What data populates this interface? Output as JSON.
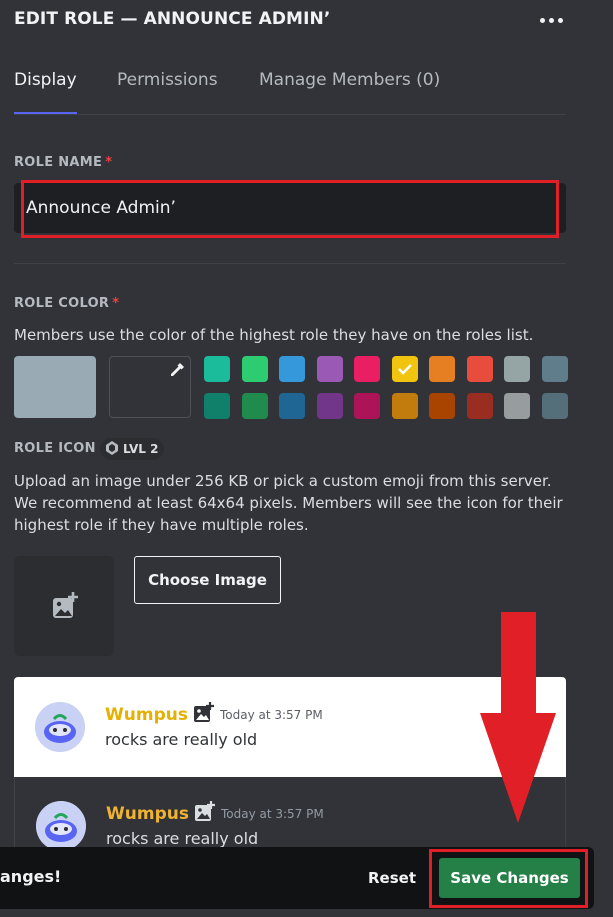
{
  "header": {
    "title": "EDIT ROLE — ANNOUNCE ADMIN’",
    "more_icon": "more-dots-icon"
  },
  "tabs": [
    {
      "label": "Display",
      "active": true
    },
    {
      "label": "Permissions",
      "active": false
    },
    {
      "label": "Manage Members (0)",
      "active": false
    }
  ],
  "role_name": {
    "label": "ROLE NAME",
    "required_mark": "*",
    "value": "Announce Admin’"
  },
  "role_color": {
    "label": "ROLE COLOR",
    "required_mark": "*",
    "description": "Members use the color of the highest role they have on the roles list.",
    "default_color": "#99aab5",
    "picker_icon": "eyedropper-icon",
    "selected": "#f1c40f",
    "row1": [
      "#1abc9c",
      "#2ecc71",
      "#3498db",
      "#9b59b6",
      "#e91e63",
      "#f1c40f",
      "#e67e22",
      "#e74c3c",
      "#95a5a6",
      "#607d8b"
    ],
    "row2": [
      "#11806a",
      "#1f8b4c",
      "#206694",
      "#71368a",
      "#ad1457",
      "#c27c0e",
      "#a84300",
      "#992d22",
      "#979c9f",
      "#546e7a"
    ]
  },
  "role_icon": {
    "label": "ROLE ICON",
    "level_badge": "LVL 2",
    "description": "Upload an image under 256 KB or pick a custom emoji from this server. We recommend at least 64x64 pixels. Members will see the icon for their highest role if they have multiple roles.",
    "upload_icon": "add-image-icon",
    "choose_label": "Choose Image"
  },
  "preview": [
    {
      "theme": "light",
      "username": "Wumpus",
      "timestamp": "Today at 3:57 PM",
      "message": "rocks are really old"
    },
    {
      "theme": "dark",
      "username": "Wumpus",
      "timestamp": "Today at 3:57 PM",
      "message": "rocks are really old"
    }
  ],
  "bottom_bar": {
    "notice": "anges!",
    "reset_label": "Reset",
    "save_label": "Save Changes"
  },
  "annotation": {
    "highlight_color": "#e01f26",
    "arrow_color": "#e01f26"
  }
}
